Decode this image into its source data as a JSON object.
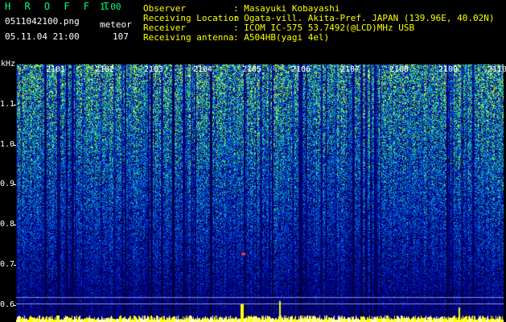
{
  "header_left": {
    "title": "H R O F F T",
    "version": "1.00",
    "filename": "0511042100.png",
    "datetime": "05.11.04 21:00",
    "meteor_label": "meteor",
    "meteor_count": "107"
  },
  "header_right": {
    "observer_label": "Observer",
    "observer_value": ": Masayuki Kobayashi",
    "location_label": "Receiving Location",
    "location_value": ": Ogata-vill. Akita-Pref. JAPAN (139.96E, 40.02N)",
    "receiver_label": "Receiver",
    "receiver_value": ": ICOM IC-575 53.7492(@LCD)MHz USB",
    "antenna_label": "Receiving antenna",
    "antenna_value": ": A504HB(yagi 4el)"
  },
  "axis": {
    "unit": "kHz",
    "y_ticks": [
      "1.1",
      "1.0",
      "0.9",
      "0.8",
      "0.7",
      "0.6"
    ],
    "x_ticks": [
      "2101",
      "2102",
      "2103",
      "2104",
      "2105",
      "2106",
      "2107",
      "2108",
      "2109",
      "2110"
    ]
  },
  "colors": {
    "header_green": "#00ff80",
    "header_yellow": "#ffff00",
    "background": "#000000"
  }
}
